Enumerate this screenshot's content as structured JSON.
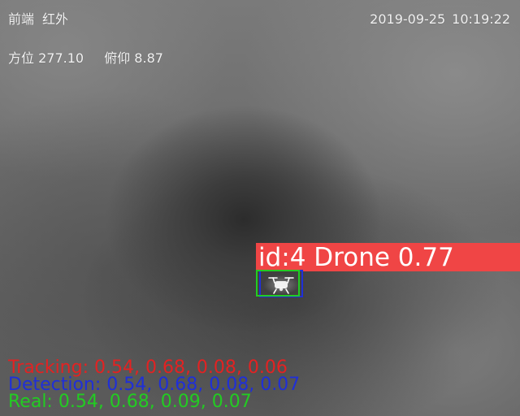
{
  "osd": {
    "source": "前端",
    "mode": "红外",
    "date": "2019-09-25",
    "time": "10:19:22",
    "azimuth_label": "方位",
    "azimuth_value": "277.10",
    "elevation_label": "俯仰",
    "elevation_value": "8.87"
  },
  "detection": {
    "label": "id:4 Drone 0.77",
    "label_color": "#f04545"
  },
  "metrics": {
    "tracking": "Tracking: 0.54, 0.68, 0.08, 0.06",
    "detection": "Detection: 0.54, 0.68, 0.08, 0.07",
    "real": "Real: 0.54, 0.68, 0.09, 0.07"
  },
  "colors": {
    "tracking": "#e32222",
    "detection": "#1f2fd8",
    "real": "#22cc22"
  },
  "icons": {
    "target": "drone-icon"
  }
}
